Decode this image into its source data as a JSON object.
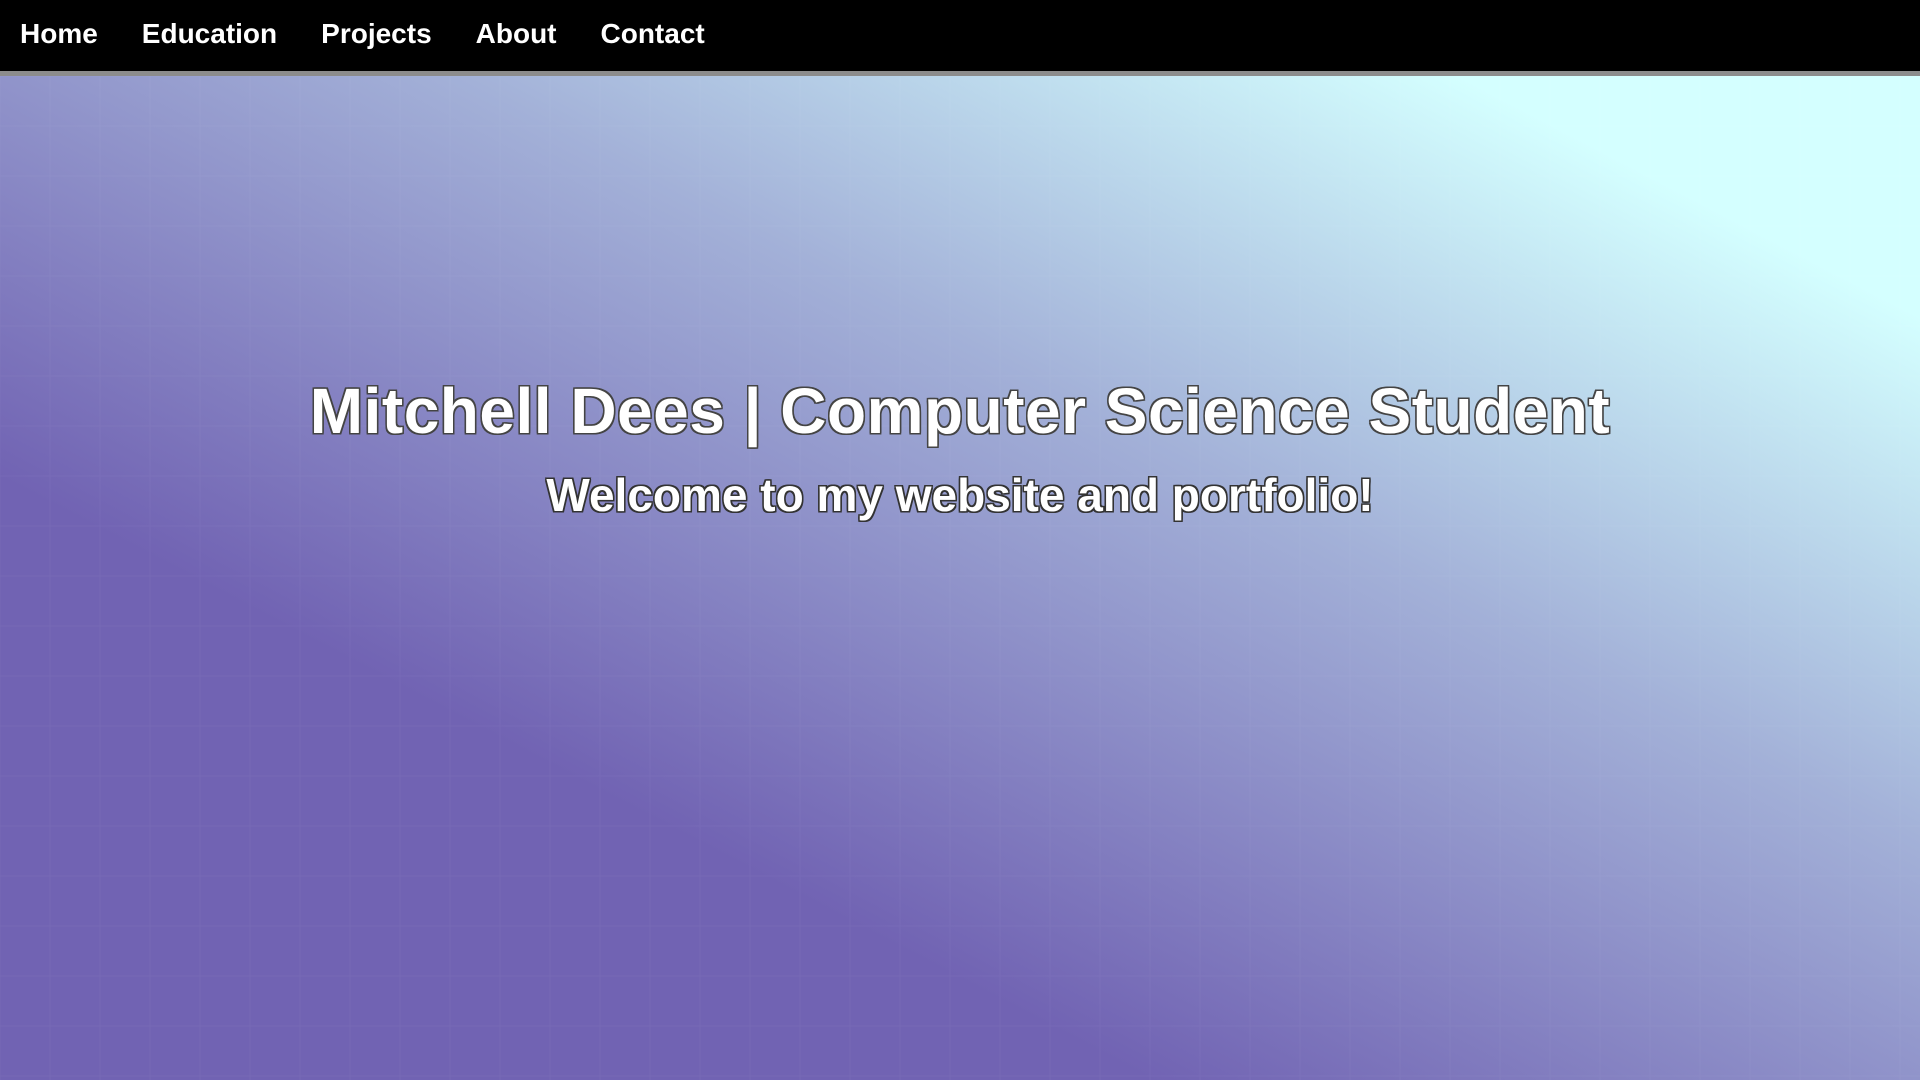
{
  "nav": {
    "items": [
      {
        "label": "Home"
      },
      {
        "label": "Education"
      },
      {
        "label": "Projects"
      },
      {
        "label": "About"
      },
      {
        "label": "Contact"
      }
    ]
  },
  "hero": {
    "title": "Mitchell Dees | Computer Science Student",
    "subtitle": "Welcome to my website and portfolio!"
  },
  "colors": {
    "navbar_bg": "#000000",
    "navbar_border": "#8c8c8c",
    "gradient_start": "#7163b3",
    "gradient_mid": "#a3b1d8",
    "gradient_end": "#d4ffff",
    "text": "#ffffff"
  }
}
